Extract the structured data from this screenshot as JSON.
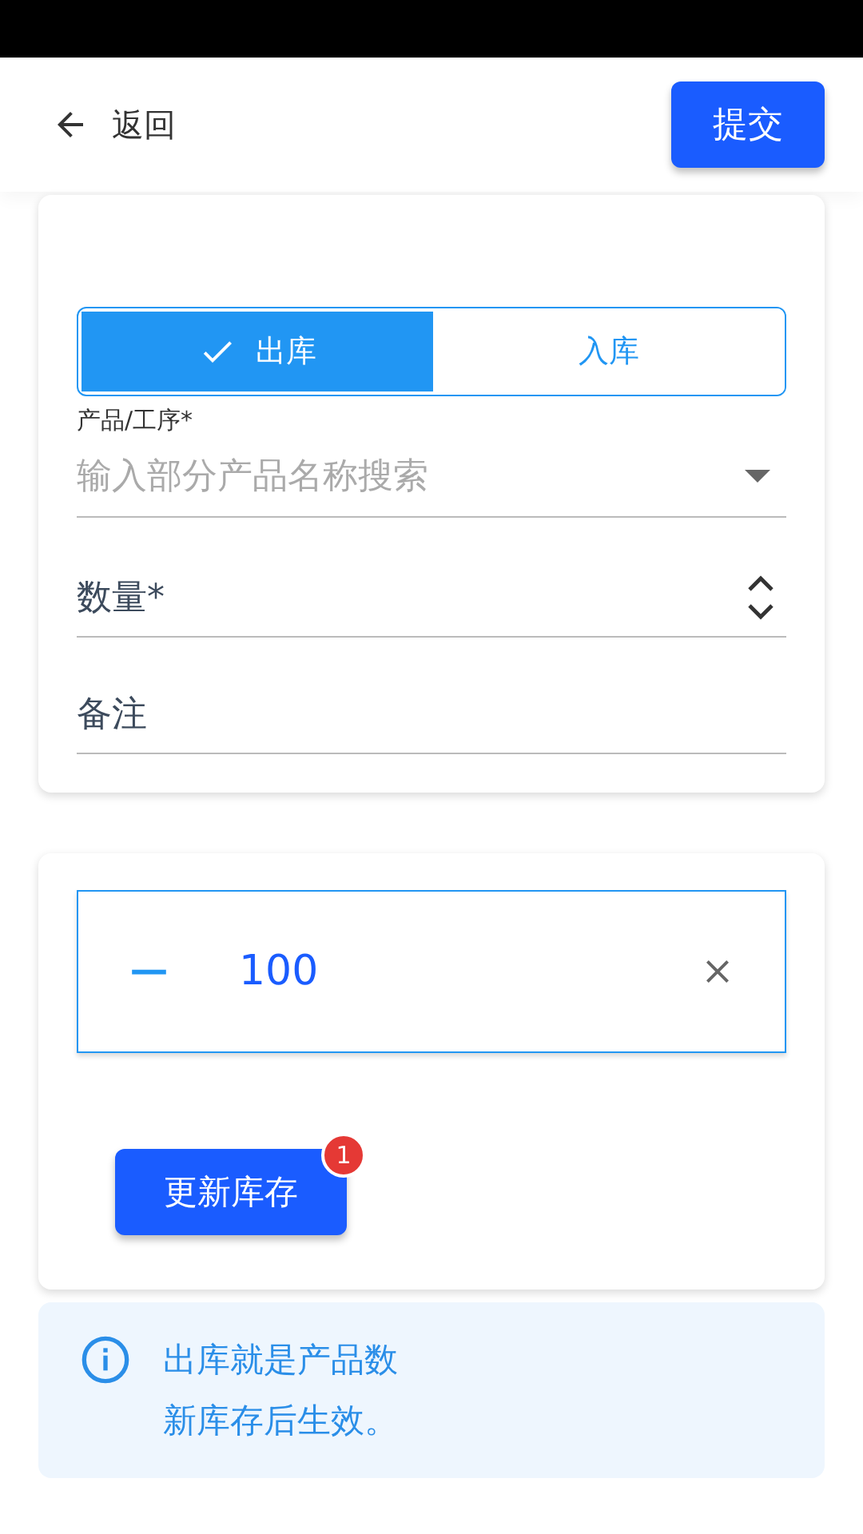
{
  "header": {
    "back_label": "返回",
    "submit_label": "提交"
  },
  "mode_toggle": [
    {
      "label": "出库",
      "selected": true
    },
    {
      "label": "入库",
      "selected": false
    }
  ],
  "product_field": {
    "label": "产品/工序*",
    "placeholder": "输入部分产品名称搜索"
  },
  "quantity_field": {
    "placeholder": "数量*"
  },
  "note_field": {
    "placeholder": "备注"
  },
  "stepper": {
    "minus": "−",
    "value": "100"
  },
  "update_button": {
    "label": "更新库存",
    "badge": "1"
  },
  "info": {
    "lines": [
      "出库就是产品数",
      "新库存后生效。"
    ]
  }
}
